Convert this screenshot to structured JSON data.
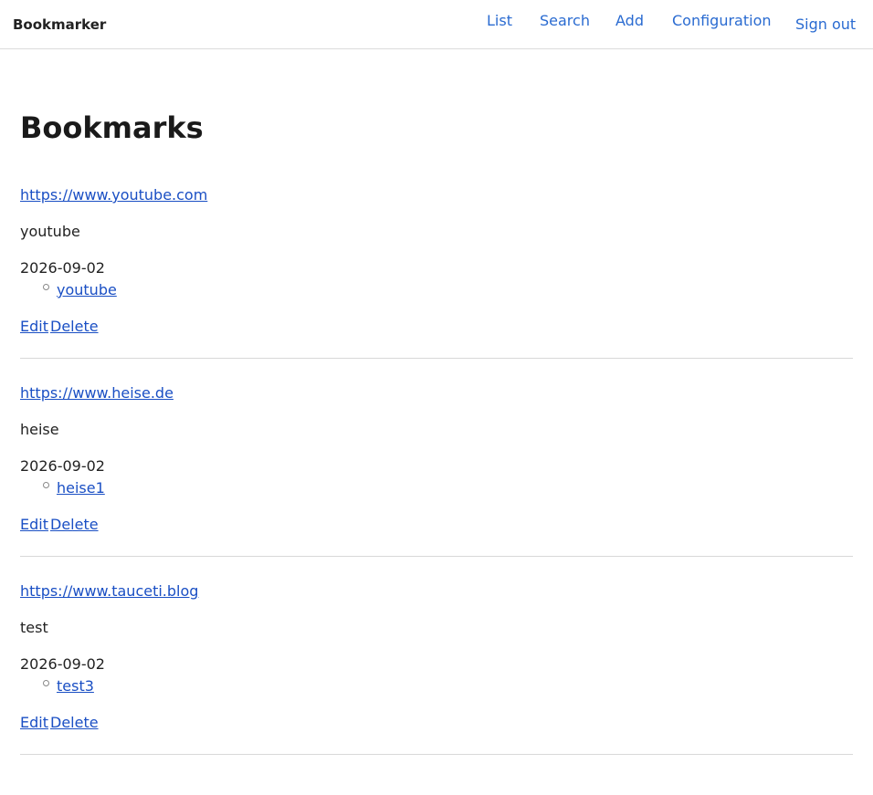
{
  "app": {
    "brand": "Bookmarker"
  },
  "nav": {
    "items": [
      {
        "label": "List"
      },
      {
        "label": "Search"
      },
      {
        "label": "Add"
      },
      {
        "label": "Configuration"
      }
    ],
    "signout": "Sign out"
  },
  "page": {
    "title": "Bookmarks"
  },
  "actions": {
    "edit": "Edit",
    "delete": "Delete"
  },
  "bookmarks": [
    {
      "url": "https://www.youtube.com",
      "title": "youtube",
      "date": "2026-09-02",
      "tags": [
        "youtube"
      ]
    },
    {
      "url": "https://www.heise.de",
      "title": "heise",
      "date": "2026-09-02",
      "tags": [
        "heise1"
      ]
    },
    {
      "url": "https://www.tauceti.blog",
      "title": "test",
      "date": "2026-09-02",
      "tags": [
        "test3"
      ]
    }
  ],
  "colors": {
    "link": "#1a4fc4",
    "nav_link": "#2a6bd1"
  }
}
